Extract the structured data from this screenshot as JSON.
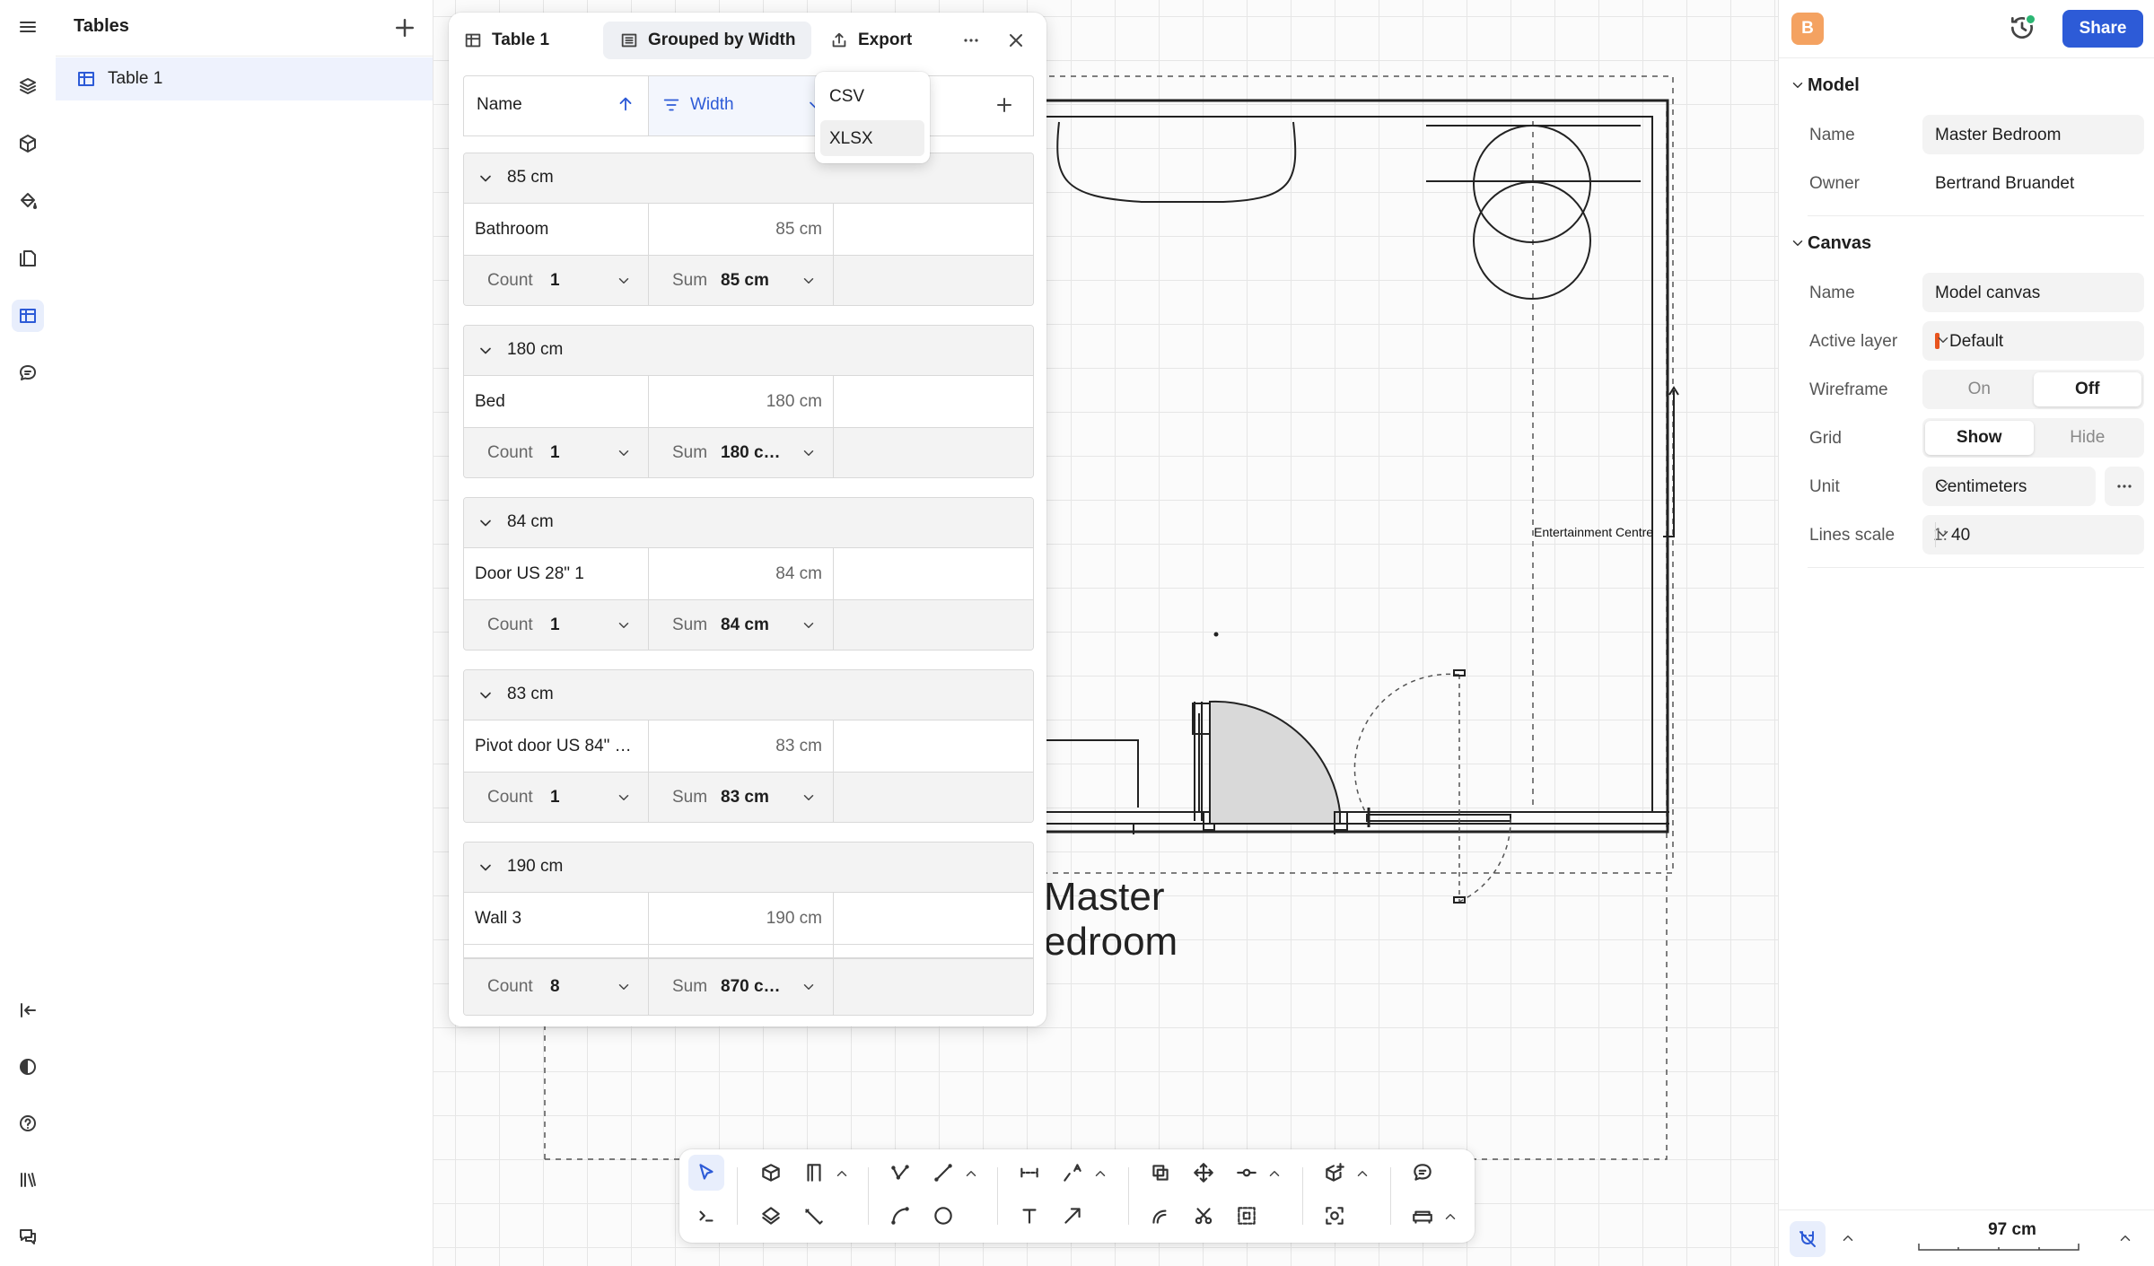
{
  "left_panel": {
    "title": "Tables",
    "items": [
      {
        "label": "Table 1"
      }
    ]
  },
  "table_panel": {
    "title": "Table 1",
    "group_button": "Grouped by Width",
    "export_button": "Export",
    "columns": [
      {
        "label": "Name"
      },
      {
        "label": "Width"
      }
    ],
    "export_menu": [
      "CSV",
      "XLSX"
    ],
    "groups": [
      {
        "header": "85 cm",
        "rows": [
          {
            "name": "Bathroom",
            "width": "85 cm"
          }
        ],
        "count_label": "Count",
        "count": "1",
        "sum_label": "Sum",
        "sum": "85 cm"
      },
      {
        "header": "180 cm",
        "rows": [
          {
            "name": "Bed",
            "width": "180 cm"
          }
        ],
        "count_label": "Count",
        "count": "1",
        "sum_label": "Sum",
        "sum": "180 c…"
      },
      {
        "header": "84 cm",
        "rows": [
          {
            "name": "Door US 28\" 1",
            "width": "84 cm"
          }
        ],
        "count_label": "Count",
        "count": "1",
        "sum_label": "Sum",
        "sum": "84 cm"
      },
      {
        "header": "83 cm",
        "rows": [
          {
            "name": "Pivot door US 84\" …",
            "width": "83 cm"
          }
        ],
        "count_label": "Count",
        "count": "1",
        "sum_label": "Sum",
        "sum": "83 cm"
      },
      {
        "header": "190 cm",
        "rows": [
          {
            "name": "Wall 3",
            "width": "190 cm"
          }
        ],
        "count_label": "Count",
        "count": "8",
        "sum_label": "Sum",
        "sum": "870 c…"
      }
    ]
  },
  "canvas": {
    "room_title_line1": "Master",
    "room_title_line2": "edroom",
    "annotation": "Entertainment Centre"
  },
  "right_panel": {
    "avatar_initial": "B",
    "share_label": "Share",
    "model": {
      "title": "Model",
      "name_label": "Name",
      "name_value": "Master Bedroom",
      "owner_label": "Owner",
      "owner_value": "Bertrand Bruandet"
    },
    "canvas": {
      "title": "Canvas",
      "name_label": "Name",
      "name_value": "Model canvas",
      "active_layer_label": "Active layer",
      "active_layer_value": "Default",
      "layer_color": "#e8541e",
      "wireframe_label": "Wireframe",
      "wireframe_on": "On",
      "wireframe_off": "Off",
      "wireframe_selected": "Off",
      "grid_label": "Grid",
      "grid_show": "Show",
      "grid_hide": "Hide",
      "grid_selected": "Show",
      "unit_label": "Unit",
      "unit_value": "Centimeters",
      "lines_scale_label": "Lines scale",
      "lines_scale_prefix": "1:",
      "lines_scale_value": "40"
    },
    "scale_readout": "97 cm"
  },
  "toolbar": {
    "tools": [
      "select-tool",
      "wall-tool",
      "door-tool",
      "polyline-tool",
      "line-tool",
      "dimension-tool",
      "label-tool",
      "copy-tool",
      "move-tool",
      "split-tool",
      "add-object-tool",
      "comment-tool",
      "terminal-tool",
      "slab-tool",
      "measure-tool",
      "arc-tool",
      "circle-tool",
      "text-tool",
      "arrow-tool",
      "offset-tool",
      "cut-tool",
      "group-tool",
      "focus-tool",
      "furniture-tool"
    ]
  },
  "colors": {
    "accent": "#2d5bd7",
    "avatar": "#f4a261",
    "active_bg": "#e8eefc"
  }
}
